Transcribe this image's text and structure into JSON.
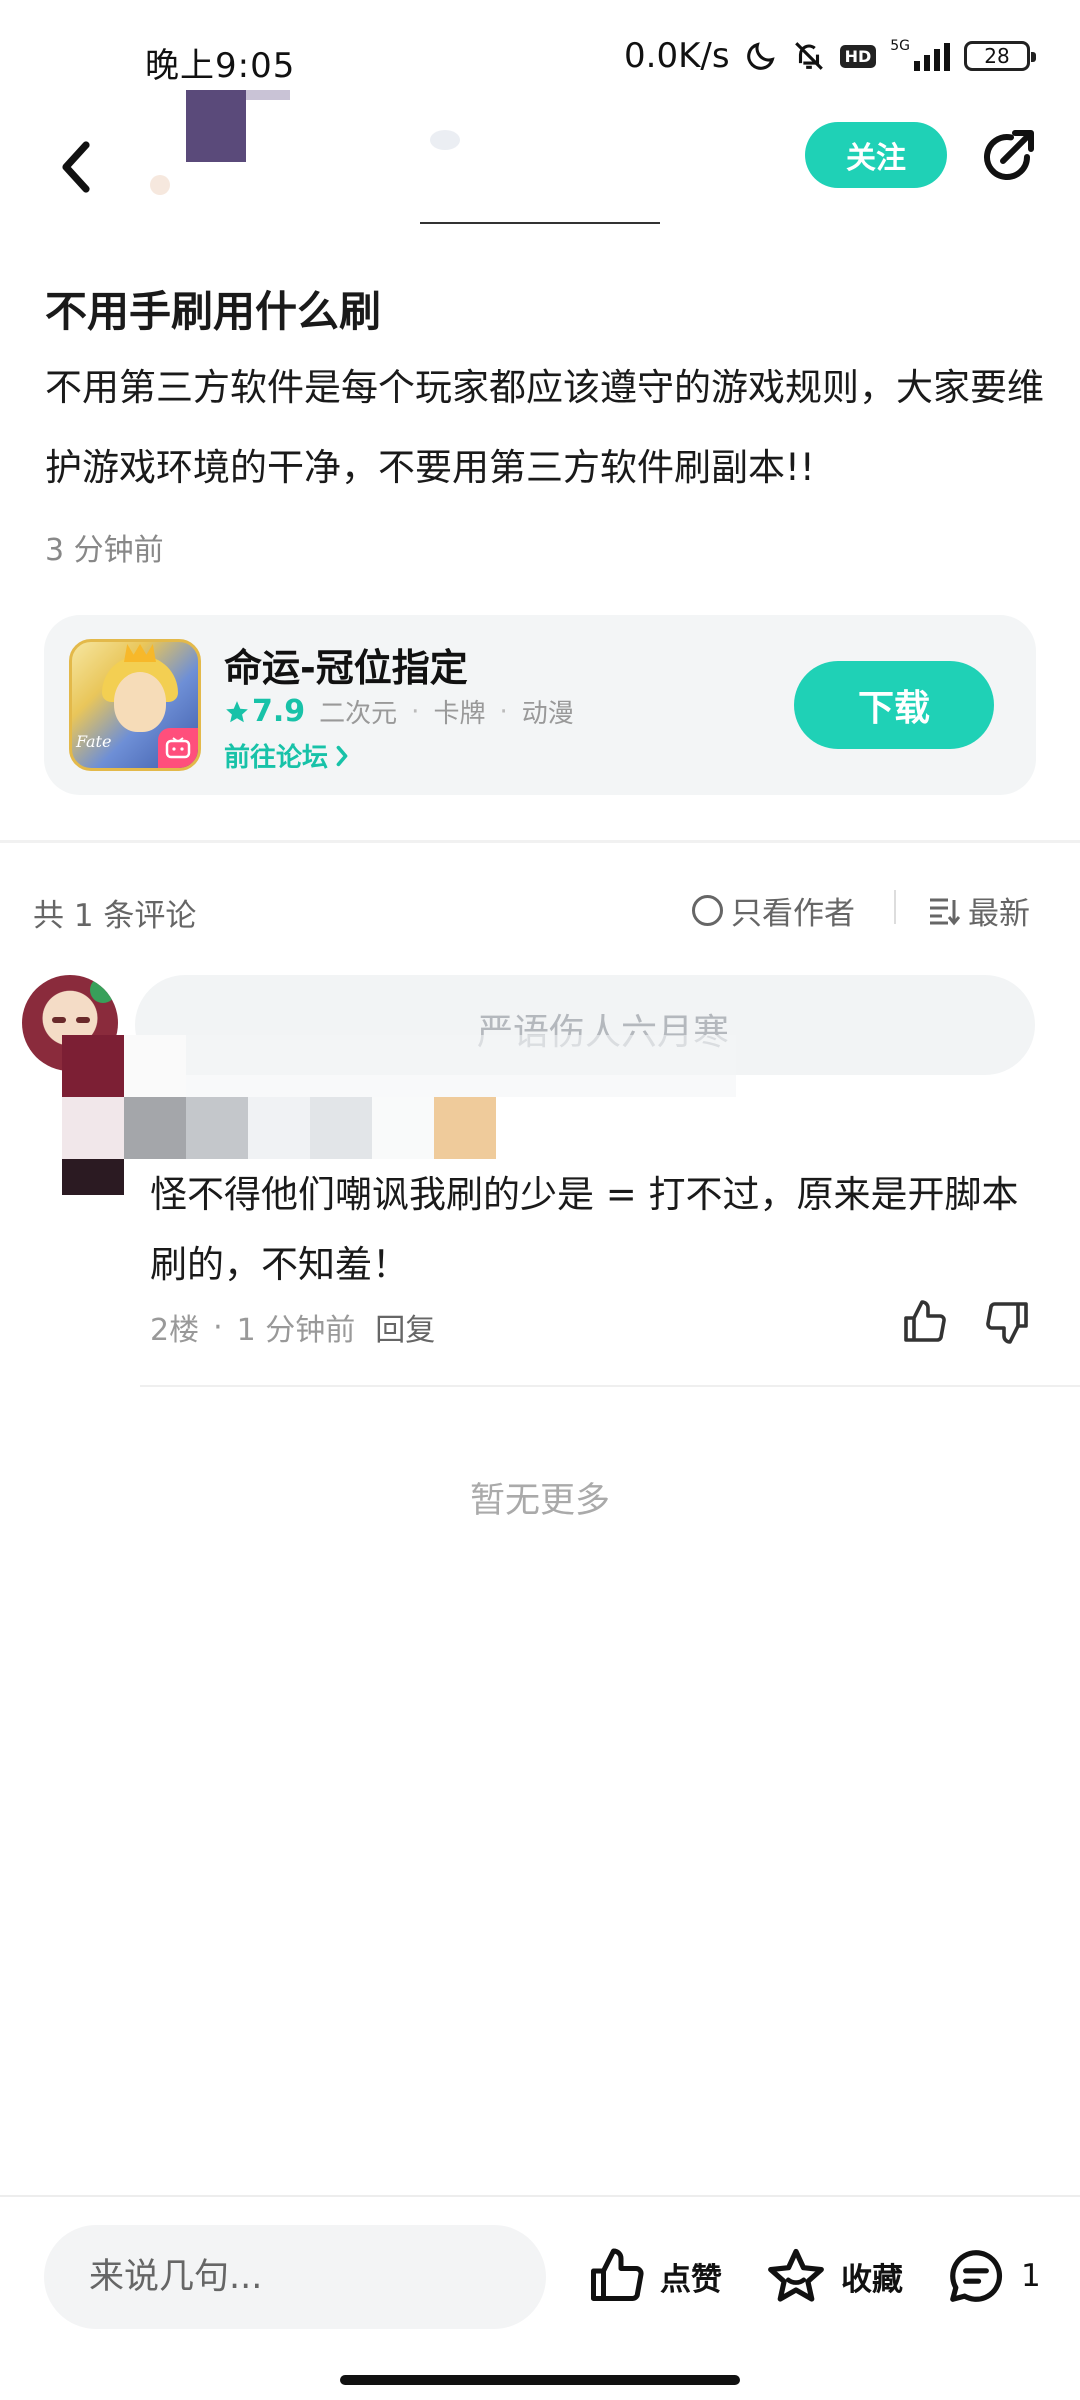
{
  "status_bar": {
    "time": "晚上9:05",
    "net_speed": "0.0K/s",
    "hd": "HD",
    "network": "5G",
    "battery": "28"
  },
  "nav": {
    "follow_label": "关注"
  },
  "post": {
    "title": "不用手刷用什么刷",
    "body": "不用第三方软件是每个玩家都应该遵守的游戏规则，大家要维护游戏环境的干净，不要用第三方软件刷副本!!",
    "time": "3 分钟前"
  },
  "game_card": {
    "name": "命运-冠位指定",
    "rating": "7.9",
    "tags": [
      "二次元",
      "卡牌",
      "动漫"
    ],
    "forum_link": "前往论坛",
    "download_label": "下载",
    "icon_text": "Fate"
  },
  "comments_header": {
    "count_text": "共 1 条评论",
    "only_author": "只看作者",
    "sort_label": "最新"
  },
  "comment": {
    "nickname": "严语伤人六月寒",
    "text": "怪不得他们嘲讽我刷的少是 = 打不过，原来是开脚本刷的，不知羞！",
    "floor": "2楼",
    "time": "1 分钟前",
    "reply_label": "回复"
  },
  "footer_text": "暂无更多",
  "bottom_bar": {
    "input_placeholder": "来说几句...",
    "like_label": "点赞",
    "fav_label": "收藏",
    "comment_count": "1"
  },
  "colors": {
    "accent": "#1fd1b6",
    "accent_text": "#18c2a8"
  }
}
